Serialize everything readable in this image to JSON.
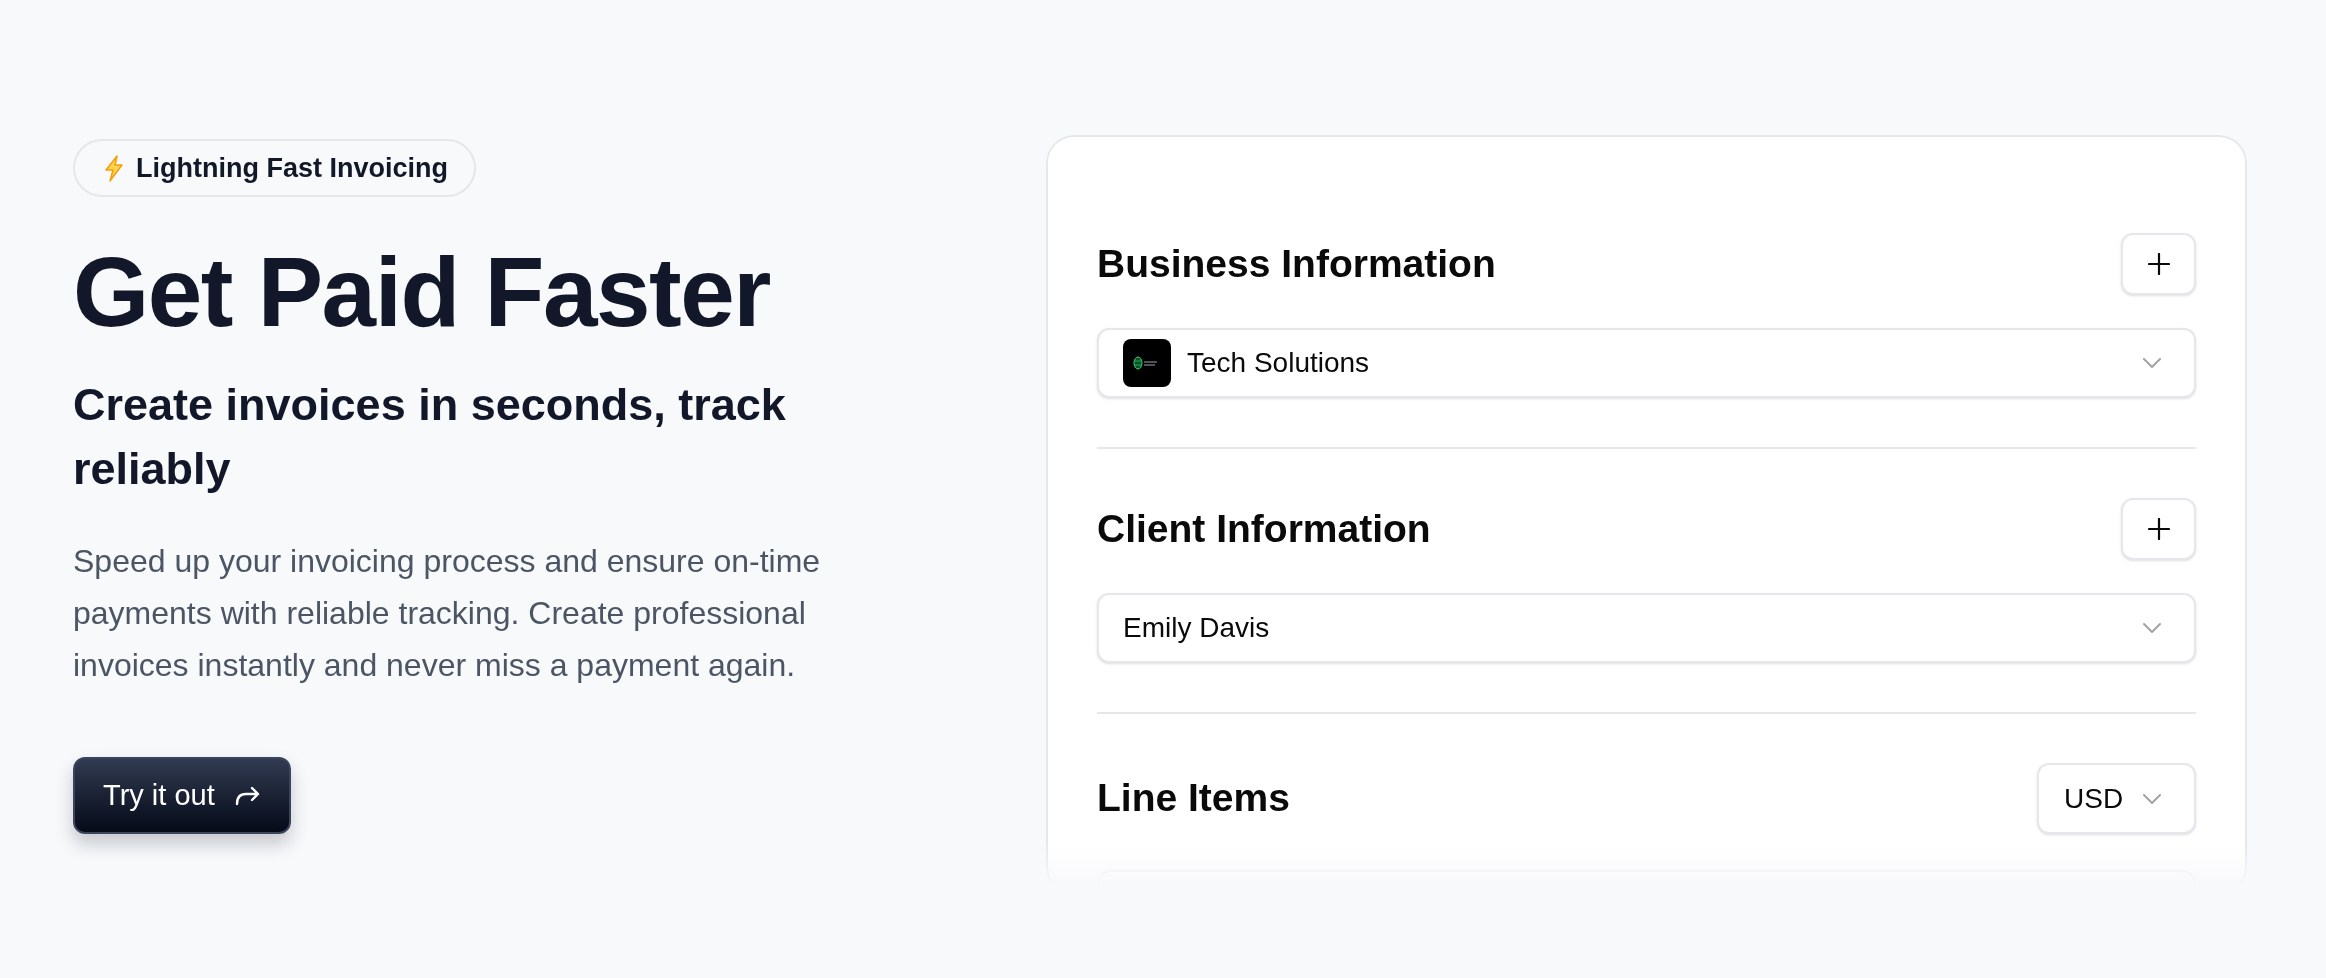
{
  "hero": {
    "badge": {
      "text": "Lightning Fast Invoicing"
    },
    "title": "Get Paid Faster",
    "subtitle": "Create invoices in seconds, track reliably",
    "description": "Speed up your invoicing process and ensure on-time payments with reliable tracking. Create professional invoices instantly and never miss a payment again.",
    "cta": {
      "label": "Try it out"
    }
  },
  "invoice_form": {
    "sections": [
      {
        "kind": "select",
        "title": "Business Information",
        "select": {
          "value": "Tech Solutions",
          "logo": true
        }
      },
      {
        "kind": "select",
        "title": "Client Information",
        "select": {
          "value": "Emily Davis",
          "logo": false
        }
      },
      {
        "kind": "line_items",
        "title": "Line Items",
        "currency": "USD"
      }
    ]
  }
}
